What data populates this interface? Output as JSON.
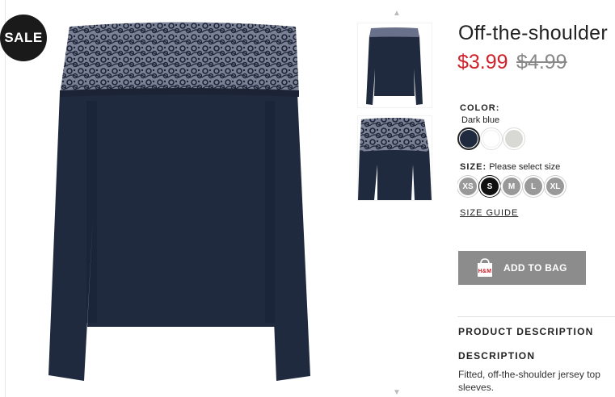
{
  "sale_badge": "SALE",
  "product": {
    "title": "Off-the-shoulder",
    "price_now": "$3.99",
    "price_old": "$4.99"
  },
  "color": {
    "label": "COLOR:",
    "value": "Dark blue",
    "swatches": [
      {
        "name": "Dark blue",
        "hex": "#1f2a3f",
        "selected": true
      },
      {
        "name": "White",
        "hex": "#ffffff",
        "selected": false
      },
      {
        "name": "Light grey",
        "hex": "#d8d8d4",
        "selected": false
      }
    ]
  },
  "size": {
    "label": "SIZE:",
    "hint": "Please select size",
    "options": [
      "XS",
      "S",
      "M",
      "L",
      "XL"
    ],
    "selected": "S",
    "guide_label": "SIZE GUIDE"
  },
  "add_to_bag": {
    "label": "ADD TO BAG",
    "icon": "shopping-bag-icon",
    "brand_mark": "H&M"
  },
  "product_description": {
    "heading": "PRODUCT DESCRIPTION",
    "description_heading": "DESCRIPTION",
    "description_text": "Fitted, off-the-shoulder jersey top sleeves."
  },
  "colors": {
    "price_red": "#d1212a",
    "button_grey": "#8c8c8c",
    "garment_navy": "#1f2a3f"
  }
}
